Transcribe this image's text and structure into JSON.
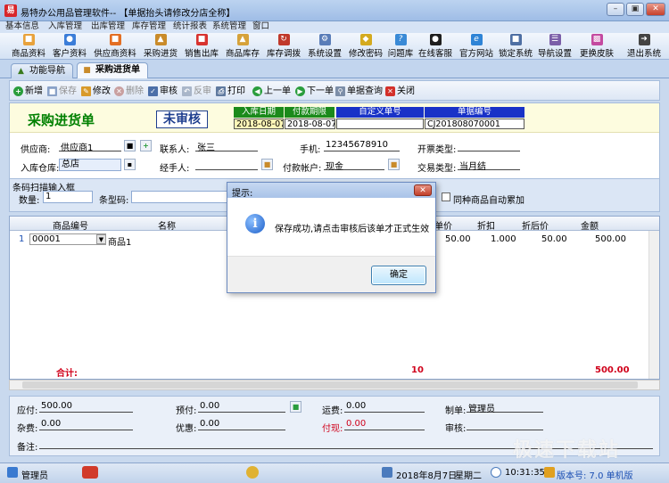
{
  "window": {
    "title": "易特办公用品管理软件-- 【单据抬头请修改分店全称】",
    "icon_text": "易"
  },
  "menu": [
    "基本信息",
    "入库管理",
    "出库管理",
    "库存管理",
    "统计报表",
    "系统管理",
    "窗口"
  ],
  "toolbar": [
    {
      "label": "商品资料",
      "icon": "box-icon",
      "color": "#e8a23c"
    },
    {
      "label": "客户资料",
      "icon": "users-icon",
      "color": "#3b7dd8"
    },
    {
      "label": "供应商资料",
      "icon": "truck-icon",
      "color": "#e36f24"
    },
    {
      "label": "采购进货",
      "icon": "cart-icon",
      "color": "#c98b2a"
    },
    {
      "label": "销售出库",
      "icon": "outbound-icon",
      "color": "#d8332f"
    },
    {
      "label": "商品库存",
      "icon": "stock-icon",
      "color": "#d6a23a"
    },
    {
      "label": "库存调拨",
      "icon": "transfer-icon",
      "color": "#c0392b"
    },
    {
      "label": "系统设置",
      "icon": "gear-icon",
      "color": "#5a7db8"
    },
    {
      "label": "修改密码",
      "icon": "key-icon",
      "color": "#d4aa1e"
    },
    {
      "label": "问题库",
      "icon": "help-icon",
      "color": "#3a8ad6"
    },
    {
      "label": "在线客服",
      "icon": "chat-icon",
      "color": "#1f1f1f"
    },
    {
      "label": "官方网站",
      "icon": "globe-icon",
      "color": "#2f84d6"
    },
    {
      "label": "锁定系统",
      "icon": "lock-icon",
      "color": "#4e6fa3"
    },
    {
      "label": "导航设置",
      "icon": "navigation-icon",
      "color": "#7b5ea8"
    },
    {
      "label": "更换皮肤",
      "icon": "palette-icon",
      "color": "#c44aa0"
    },
    {
      "label": "退出系统",
      "icon": "exit-icon",
      "color": "#444444"
    }
  ],
  "tabs": [
    "功能导航",
    "采购进货单"
  ],
  "actions": {
    "new": "新增",
    "save": "保存",
    "edit": "修改",
    "delete": "删除",
    "audit": "审核",
    "unaudit": "反审",
    "print": "打印",
    "prev": "上一单",
    "next": "下一单",
    "query": "单据查询",
    "close": "关闭"
  },
  "doc": {
    "title": "采购进货单",
    "status_stamp": "未审核",
    "date_headers": [
      "入库日期",
      "付款期限",
      "自定义单号",
      "单据编号"
    ],
    "date_values": [
      "2018-08-07",
      "2018-08-07",
      "",
      "CJ201808070001"
    ]
  },
  "form": {
    "supplier_label": "供应商:",
    "supplier_value": "供应商1",
    "contact_label": "联系人:",
    "contact_value": "张三",
    "phone_label": "手机:",
    "phone_value": "12345678910",
    "invoice_label": "开票类型:",
    "invoice_value": "",
    "warehouse_label": "入库仓库:",
    "warehouse_value": "总店",
    "handler_label": "经手人:",
    "handler_value": "",
    "account_label": "付款帐户:",
    "account_value": "现金",
    "trade_label": "交易类型:",
    "trade_value": "当月结"
  },
  "barcode": {
    "legend": "条码扫描输入框",
    "qty_label": "数量:",
    "qty_value": "1",
    "code_label": "条型码:",
    "code_value": "",
    "auto_add_label": "同种商品自动累加"
  },
  "grid": {
    "columns": [
      "商品编号",
      "名称",
      "单价",
      "折扣",
      "折后价",
      "金额"
    ],
    "rows": [
      {
        "index": "1",
        "code": "00001",
        "name": "商品1",
        "price": "50.00",
        "discount": "1.000",
        "after": "50.00",
        "amount": "500.00"
      }
    ],
    "total_label": "合计:",
    "total_qty": "10",
    "total_amount": "500.00"
  },
  "footer": {
    "payable_label": "应付:",
    "payable_value": "500.00",
    "prepaid_label": "预付:",
    "prepaid_value": "0.00",
    "freight_label": "运费:",
    "freight_value": "0.00",
    "maker_label": "制单:",
    "maker_value": "管理员",
    "misc_label": "杂费:",
    "misc_value": "0.00",
    "discount_label": "优惠:",
    "discount_value": "0.00",
    "paid_label": "付现:",
    "paid_value": "0.00",
    "auditor_label": "审核:",
    "auditor_value": "",
    "note_label": "备注:",
    "note_value": ""
  },
  "status": {
    "user": "管理员",
    "date": "2018年8月7日",
    "weekday": "星期二",
    "time": "10:31:35",
    "version": "版本号: 7.0 单机版"
  },
  "dialog": {
    "title": "提示:",
    "message": "保存成功,请点击审核后该单才正式生效",
    "ok": "确定"
  },
  "watermark": "极速下载站"
}
